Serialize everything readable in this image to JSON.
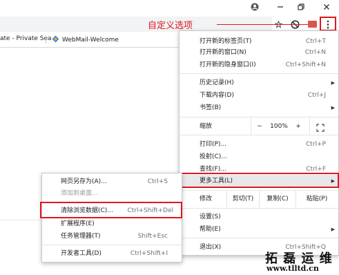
{
  "window": {
    "account_icon": "account-circle-icon",
    "minimize_icon": "minimize-icon",
    "restore_icon": "restore-icon",
    "close_icon": "close-icon"
  },
  "toolbar": {
    "star_icon": "bookmark-star-icon",
    "extension_icon": "blocked-extension-icon",
    "menu_icon": "kebab-menu-icon"
  },
  "bookmarks": [
    {
      "label": "ate - Private Sea",
      "icon": "page-icon"
    },
    {
      "label": "WebMail-Welcome",
      "icon": "webmail-icon"
    }
  ],
  "annotation": {
    "label": "自定义选项",
    "color": "#e0161e"
  },
  "menu": {
    "new_tab": {
      "label": "打开新的标签页(T)",
      "shortcut": "Ctrl+T"
    },
    "new_window": {
      "label": "打开新的窗口(N)",
      "shortcut": "Ctrl+N"
    },
    "new_incognito": {
      "label": "打开新的隐身窗口(I)",
      "shortcut": "Ctrl+Shift+N"
    },
    "history": {
      "label": "历史记录(H)"
    },
    "downloads": {
      "label": "下载内容(D)",
      "shortcut": "Ctrl+J"
    },
    "bookmarks": {
      "label": "书签(B)"
    },
    "zoom": {
      "label": "缩放",
      "minus": "−",
      "value": "100%",
      "plus": "+",
      "fullscreen_icon": "fullscreen-icon"
    },
    "print": {
      "label": "打印(P)...",
      "shortcut": "Ctrl+P"
    },
    "cast": {
      "label": "投射(C)..."
    },
    "find": {
      "label": "查找(F)...",
      "shortcut": "Ctrl+F"
    },
    "more_tools": {
      "label": "更多工具(L)"
    },
    "edit": {
      "label": "修改",
      "cut": "剪切(T)",
      "copy": "复制(C)",
      "paste": "粘贴(P)"
    },
    "settings": {
      "label": "设置(S)"
    },
    "help": {
      "label": "帮助(E)"
    },
    "exit": {
      "label": "退出(X)",
      "shortcut": "Ctrl+Shift+Q"
    }
  },
  "submenu": {
    "save_page": {
      "label": "网页另存为(A)...",
      "shortcut": "Ctrl+S"
    },
    "add_desktop": {
      "label": "添加到桌面..."
    },
    "clear_data": {
      "label": "清除浏览数据(C)...",
      "shortcut": "Ctrl+Shift+Del"
    },
    "extensions": {
      "label": "扩展程序(E)"
    },
    "task_manager": {
      "label": "任务管理器(T)",
      "shortcut": "Shift+Esc"
    },
    "devtools": {
      "label": "开发者工具(D)",
      "shortcut": "Ctrl+Shift+I"
    }
  },
  "watermark": {
    "text": "拓 磊 运 维",
    "url": "www.tlltd.cn"
  }
}
